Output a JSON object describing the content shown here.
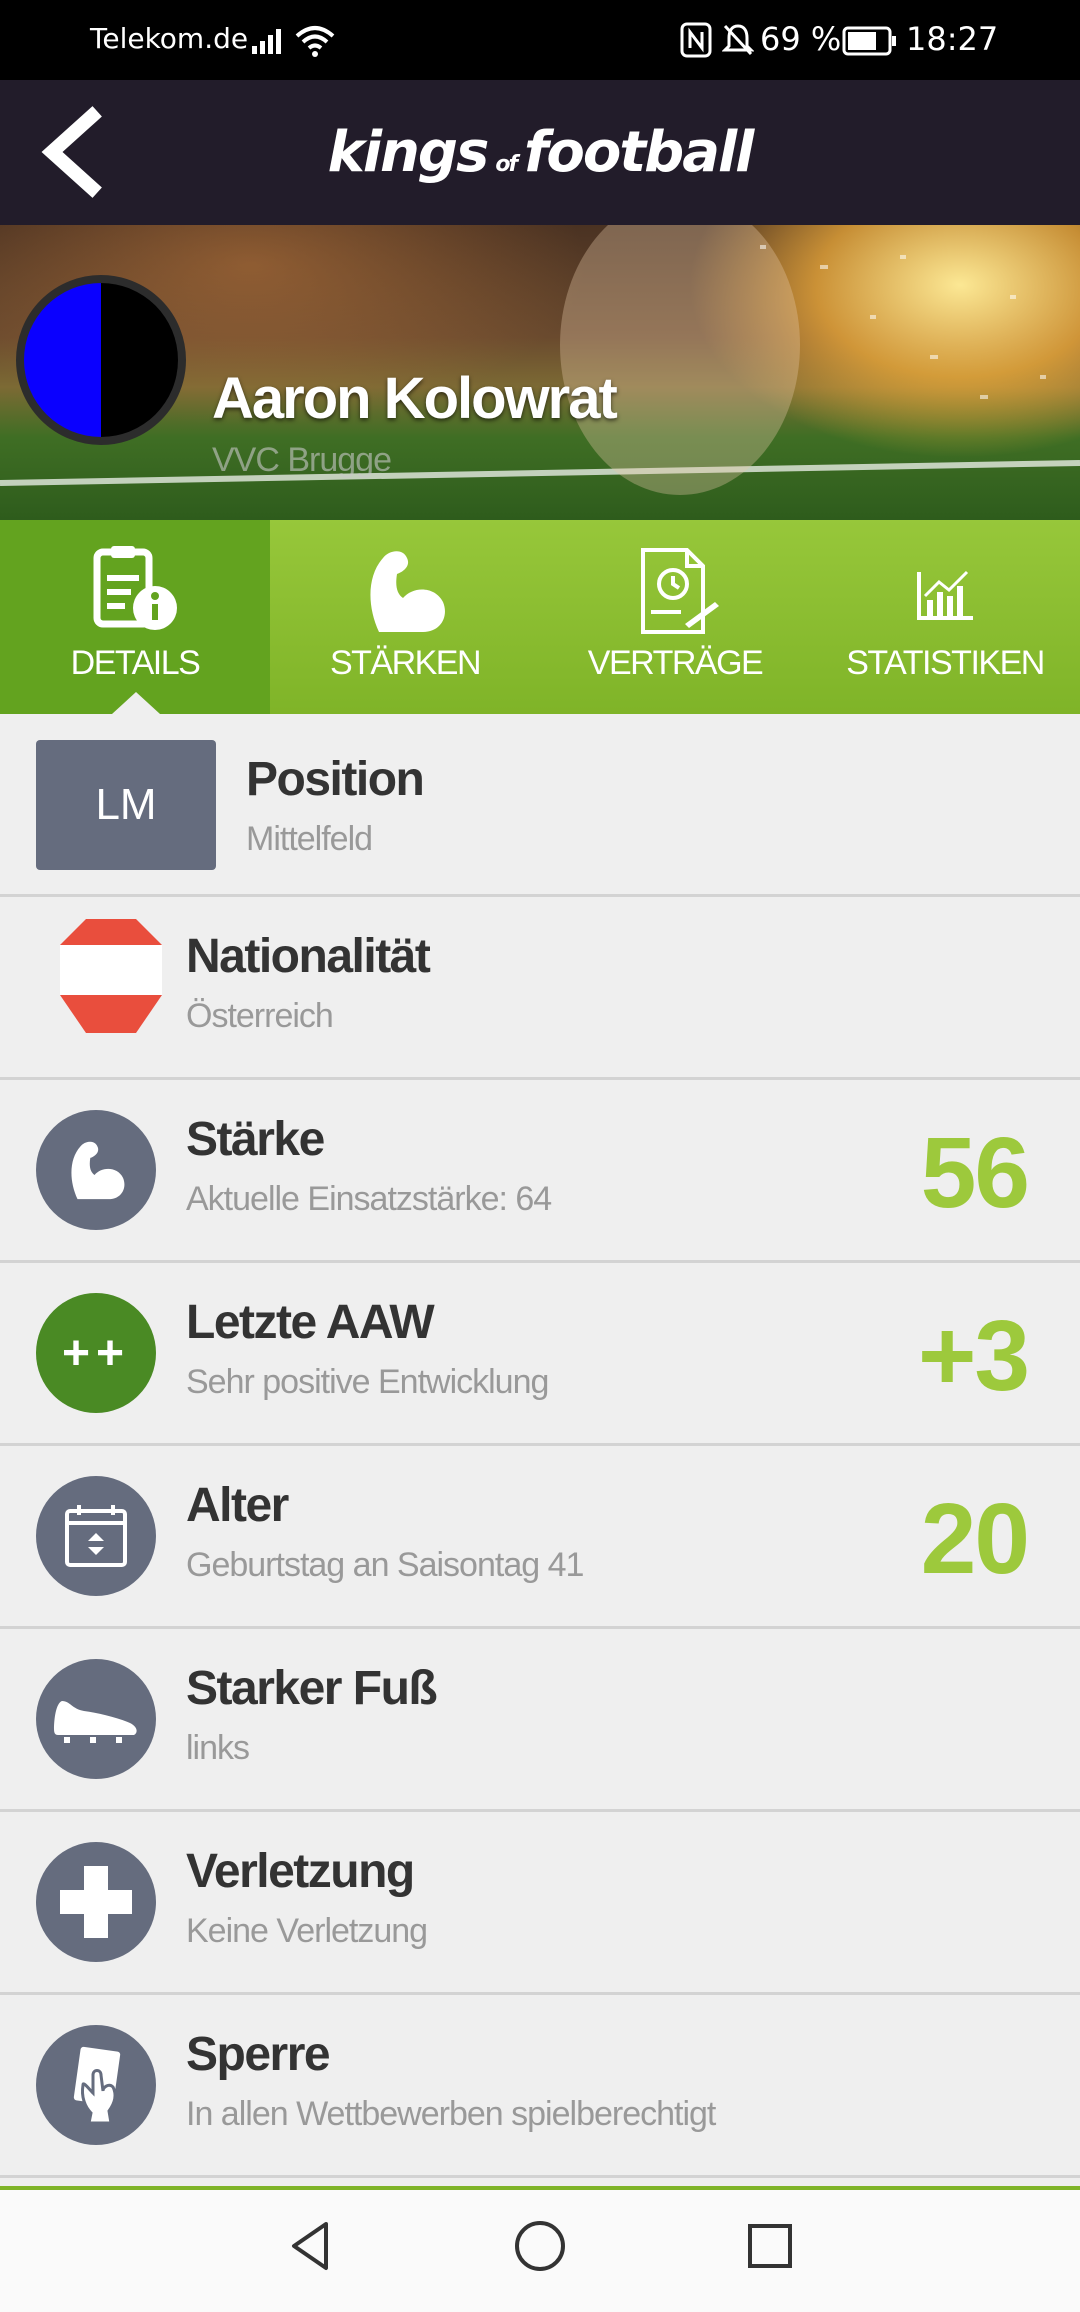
{
  "status_bar": {
    "carrier": "Telekom.de",
    "battery_text": "69 %",
    "time": "18:27"
  },
  "header": {
    "logo_word1": "kings",
    "logo_word2": "of",
    "logo_word3": "football"
  },
  "player": {
    "name": "Aaron Kolowrat",
    "club": "VVC Brugge",
    "colors": [
      "#0a00ff",
      "#000000"
    ]
  },
  "tabs": [
    {
      "label": "DETAILS",
      "icon": "document-info-icon",
      "active": true
    },
    {
      "label": "STÄRKEN",
      "icon": "flexed-arm-icon",
      "active": false
    },
    {
      "label": "VERTRÄGE",
      "icon": "contract-icon",
      "active": false
    },
    {
      "label": "STATISTIKEN",
      "icon": "chart-icon",
      "active": false
    }
  ],
  "details": {
    "position": {
      "badge": "LM",
      "title": "Position",
      "value": "Mittelfeld"
    },
    "nationality": {
      "title": "Nationalität",
      "value": "Österreich",
      "flag_colors": [
        "#e94e3d",
        "#ffffff",
        "#e94e3d"
      ]
    },
    "strength": {
      "title": "Stärke",
      "value": "Aktuelle Einsatzstärke: 64",
      "big": "56",
      "icon": "flexed-arm-icon"
    },
    "last_aaw": {
      "title": "Letzte AAW",
      "value": "Sehr positive Entwicklung",
      "big": "+3",
      "icon_text": "++"
    },
    "age": {
      "title": "Alter",
      "value": "Geburtstag an Saisontag 41",
      "big": "20",
      "icon": "calendar-icon"
    },
    "foot": {
      "title": "Starker Fuß",
      "value": "links",
      "icon": "football-boot-icon"
    },
    "injury": {
      "title": "Verletzung",
      "value": "Keine Verletzung",
      "icon": "medical-cross-icon"
    },
    "suspension": {
      "title": "Sperre",
      "value": "In allen Wettbewerben spielberechtigt",
      "icon": "red-card-icon"
    }
  },
  "colors": {
    "accent_green": "#9dc93c",
    "tab_active": "#63a31f",
    "header_bg": "#221c2a",
    "icon_bg": "#656c7e"
  }
}
